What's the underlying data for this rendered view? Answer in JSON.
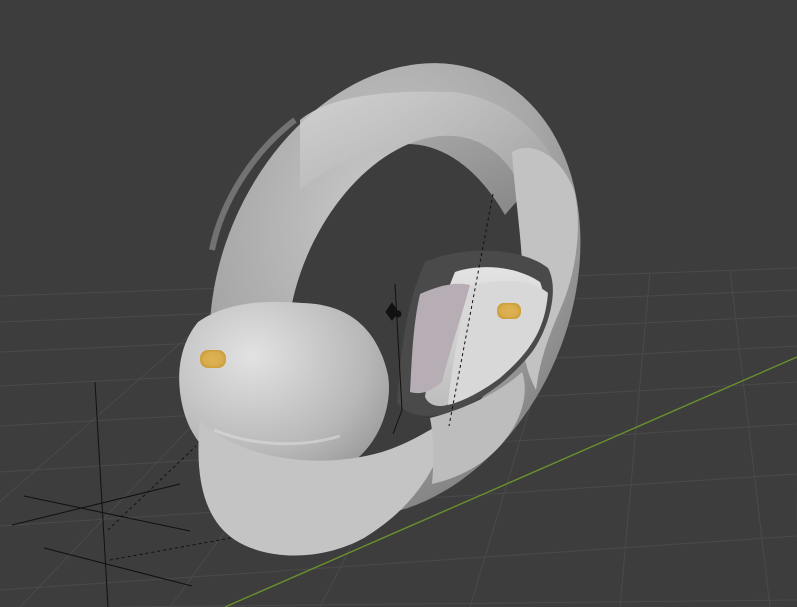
{
  "viewport": {
    "background_color": "#3d3d3d",
    "grid_line_color": "#4b4b4b",
    "x_axis_color": "#6a8f2c",
    "model_body_color": "#a9a9a9",
    "model_highlight_color": "#cfcfcf",
    "model_shadow_color": "#777777",
    "canopy_color": "#b9b9b9",
    "seat_color": "#d6d6d6",
    "seat_trim_color": "#b7adb4",
    "light_color": "#d9ad4c",
    "object_origin_icon": "origin-point-icon",
    "camera_helper_icon": "camera-object-icon",
    "light_helper_icon": "light-object-icon"
  }
}
